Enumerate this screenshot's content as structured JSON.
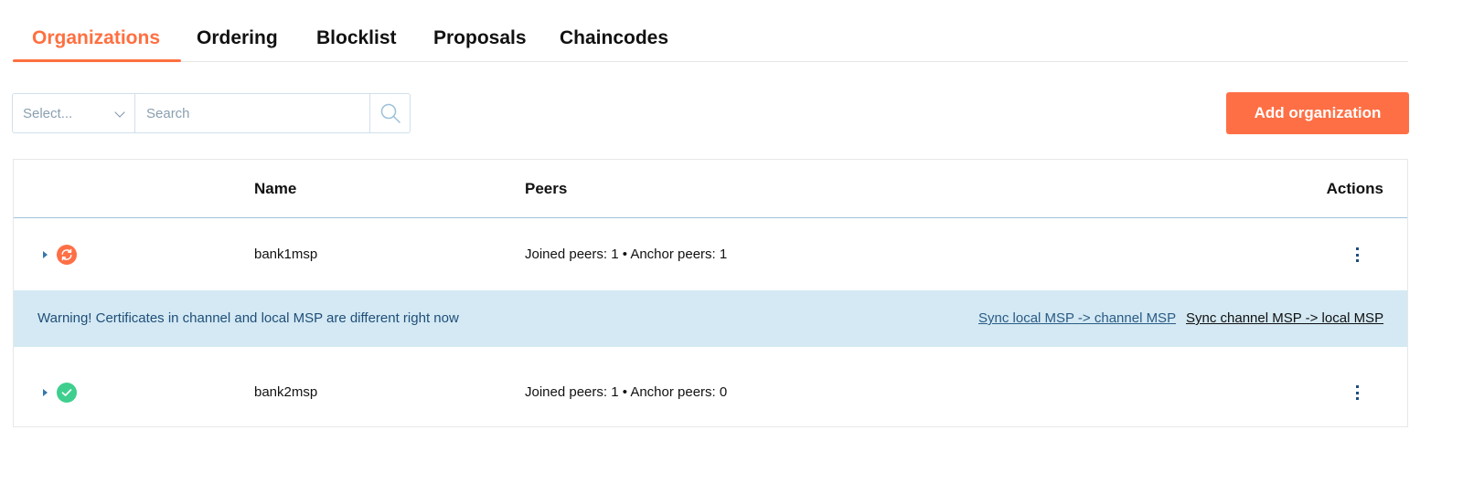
{
  "tabs": [
    {
      "label": "Organizations",
      "active": true
    },
    {
      "label": "Ordering",
      "active": false
    },
    {
      "label": "Blocklist",
      "active": false
    },
    {
      "label": "Proposals",
      "active": false
    },
    {
      "label": "Chaincodes",
      "active": false
    }
  ],
  "filter": {
    "select_placeholder": "Select...",
    "search_placeholder": "Search",
    "search_value": ""
  },
  "actions": {
    "add_label": "Add organization"
  },
  "table": {
    "columns": [
      "Name",
      "Peers",
      "Actions"
    ],
    "rows": [
      {
        "name": "bank1msp",
        "peers": "Joined peers: 1 • Anchor peers: 1",
        "status": "sync-needed",
        "status_icon": "refresh-icon",
        "status_color": "#ff6f45"
      },
      {
        "name": "bank2msp",
        "peers": "Joined peers: 1 • Anchor peers: 0",
        "status": "ok",
        "status_icon": "check-icon",
        "status_color": "#3ecf8e"
      }
    ],
    "warning": {
      "text": "Warning! Certificates in channel and local MSP are different right now",
      "link_local_to_channel": "Sync local MSP -> channel MSP",
      "link_channel_to_local": "Sync channel MSP -> local MSP"
    }
  },
  "colors": {
    "accent": "#ff6f45",
    "success": "#3ecf8e",
    "warning_bg": "#d4e9f3",
    "link": "#2a5b86"
  }
}
